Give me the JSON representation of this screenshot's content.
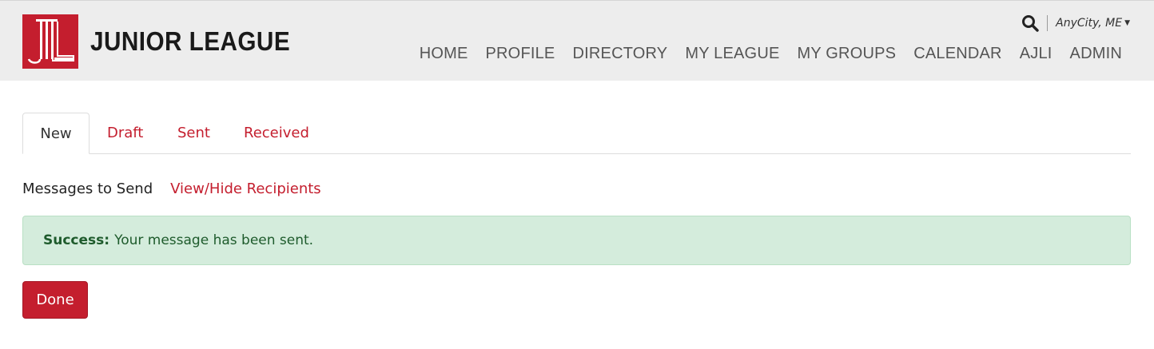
{
  "brand": {
    "name": "JUNIOR LEAGUE",
    "logo_icon": "junior-league-column-logo-icon",
    "color": "#c41e2e"
  },
  "utility": {
    "search_icon": "search-icon",
    "location": "AnyCity, ME"
  },
  "nav": {
    "items": [
      {
        "label": "HOME"
      },
      {
        "label": "PROFILE"
      },
      {
        "label": "DIRECTORY"
      },
      {
        "label": "MY LEAGUE"
      },
      {
        "label": "MY GROUPS"
      },
      {
        "label": "CALENDAR"
      },
      {
        "label": "AJLI"
      },
      {
        "label": "ADMIN"
      }
    ]
  },
  "tabs": {
    "items": [
      {
        "label": "New",
        "active": true
      },
      {
        "label": "Draft",
        "active": false
      },
      {
        "label": "Sent",
        "active": false
      },
      {
        "label": "Received",
        "active": false
      }
    ]
  },
  "messages": {
    "label": "Messages to Send",
    "toggle_link": "View/Hide Recipients"
  },
  "alert": {
    "strong": "Success:",
    "text": "Your message has been sent.",
    "bg_color": "#d4ecdc",
    "text_color": "#1e5b2c"
  },
  "actions": {
    "done_label": "Done"
  }
}
